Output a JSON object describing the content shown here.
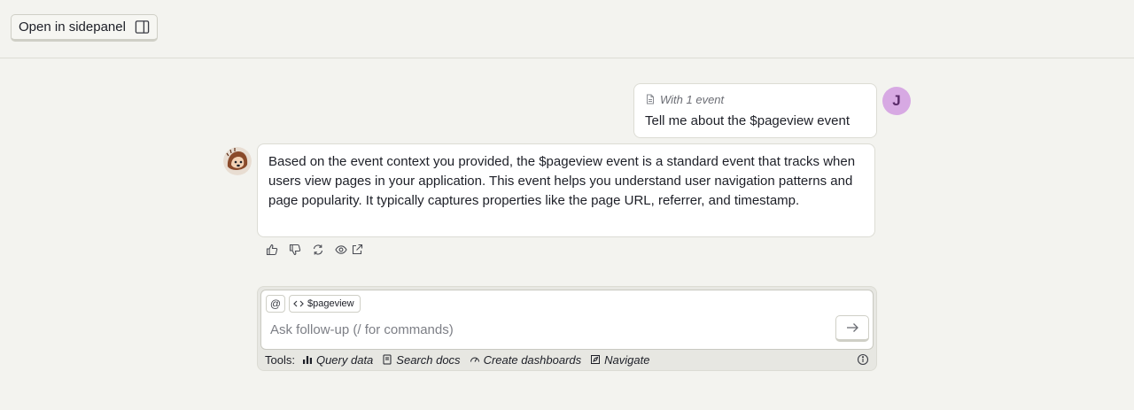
{
  "header": {
    "open_sidepanel_label": "Open in sidepanel"
  },
  "user_message": {
    "context_label": "With 1 event",
    "text": "Tell me about the $pageview event",
    "avatar_initial": "J"
  },
  "assistant_message": {
    "text": "Based on the event context you provided, the $pageview event is a standard event that tracks when users view pages in your application. This event helps you understand user navigation patterns and page popularity. It typically captures properties like the page URL, referrer, and timestamp."
  },
  "message_actions": [
    "thumbs-up-icon",
    "thumbs-down-icon",
    "retry-icon",
    "eye-icon",
    "external-link-icon"
  ],
  "composer": {
    "mention_label": "@",
    "context_chip_label": "$pageview",
    "placeholder": "Ask follow-up (/ for commands)",
    "tools_label": "Tools:",
    "tools": [
      {
        "label": "Query data",
        "icon": "bar-chart-icon"
      },
      {
        "label": "Search docs",
        "icon": "book-icon"
      },
      {
        "label": "Create dashboards",
        "icon": "gauge-icon"
      },
      {
        "label": "Navigate",
        "icon": "compass-icon"
      }
    ]
  },
  "colors": {
    "background": "#f3f3ef",
    "user_avatar_bg": "#d7a9e3",
    "border": "#dcdcd4"
  }
}
